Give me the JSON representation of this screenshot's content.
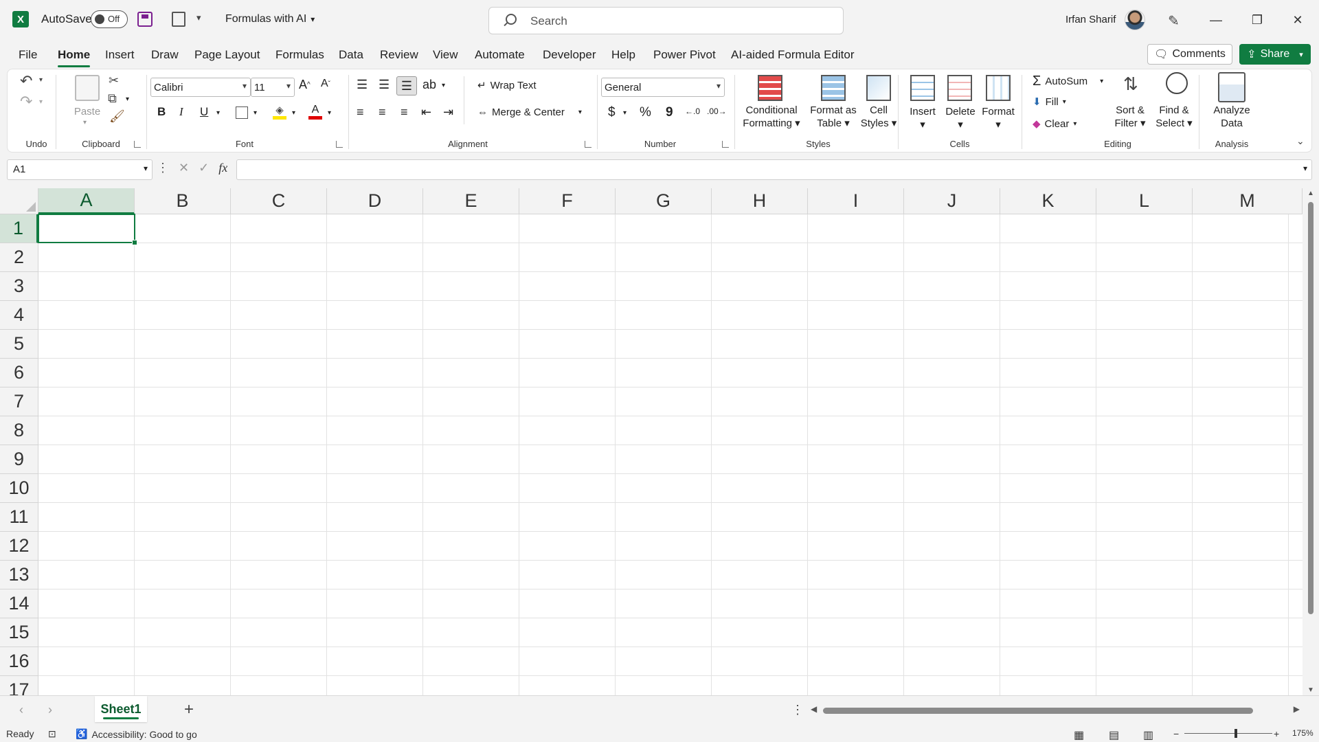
{
  "titlebar": {
    "logo": "X",
    "autosave_label": "AutoSave",
    "autosave_state": "Off",
    "doc_title": "Formulas with AI",
    "search_placeholder": "Search",
    "user_name": "Irfan Sharif"
  },
  "tabs": [
    {
      "label": "File"
    },
    {
      "label": "Home"
    },
    {
      "label": "Insert"
    },
    {
      "label": "Draw"
    },
    {
      "label": "Page Layout"
    },
    {
      "label": "Formulas"
    },
    {
      "label": "Data"
    },
    {
      "label": "Review"
    },
    {
      "label": "View"
    },
    {
      "label": "Automate"
    },
    {
      "label": "Developer"
    },
    {
      "label": "Help"
    },
    {
      "label": "Power Pivot"
    },
    {
      "label": "AI-aided Formula Editor"
    }
  ],
  "actions": {
    "comments": "Comments",
    "share": "Share"
  },
  "ribbon": {
    "groups": {
      "undo": "Undo",
      "clipboard": "Clipboard",
      "font": "Font",
      "alignment": "Alignment",
      "number": "Number",
      "styles": "Styles",
      "cells": "Cells",
      "editing": "Editing",
      "analysis": "Analysis"
    },
    "clipboard": {
      "paste": "Paste"
    },
    "font": {
      "name": "Calibri",
      "size": "11",
      "bold": "B",
      "italic": "I",
      "underline": "U",
      "font_color": "A"
    },
    "alignment": {
      "wrap_text": "Wrap Text",
      "merge_center": "Merge & Center"
    },
    "number": {
      "format": "General",
      "currency": "$",
      "percent": "%",
      "comma": "9"
    },
    "styles": {
      "conditional_1": "Conditional",
      "conditional_2": "Formatting",
      "format_table_1": "Format as",
      "format_table_2": "Table",
      "cell_styles_1": "Cell",
      "cell_styles_2": "Styles"
    },
    "cells": {
      "insert": "Insert",
      "delete": "Delete",
      "format": "Format"
    },
    "editing": {
      "autosum": "AutoSum",
      "fill": "Fill",
      "clear": "Clear",
      "sort_1": "Sort &",
      "sort_2": "Filter",
      "find_1": "Find &",
      "find_2": "Select"
    },
    "analysis": {
      "analyze_1": "Analyze",
      "analyze_2": "Data"
    }
  },
  "formula_bar": {
    "name_box": "A1",
    "fx": "fx",
    "formula": ""
  },
  "grid": {
    "columns": [
      "A",
      "B",
      "C",
      "D",
      "E",
      "F",
      "G",
      "H",
      "I",
      "J",
      "K",
      "L",
      "M"
    ],
    "rows": [
      "1",
      "2",
      "3",
      "4",
      "5",
      "6",
      "7",
      "8",
      "9",
      "10",
      "11",
      "12",
      "13",
      "14",
      "15",
      "16",
      "17"
    ],
    "active_cell": "A1"
  },
  "sheets": {
    "active": "Sheet1",
    "add": "+"
  },
  "status": {
    "mode": "Ready",
    "accessibility": "Accessibility: Good to go",
    "zoom": "175%"
  },
  "colors": {
    "accent": "#107c41",
    "save_icon": "#7a1f8f",
    "fill_yellow": "#ffe600",
    "font_red": "#e00000"
  }
}
